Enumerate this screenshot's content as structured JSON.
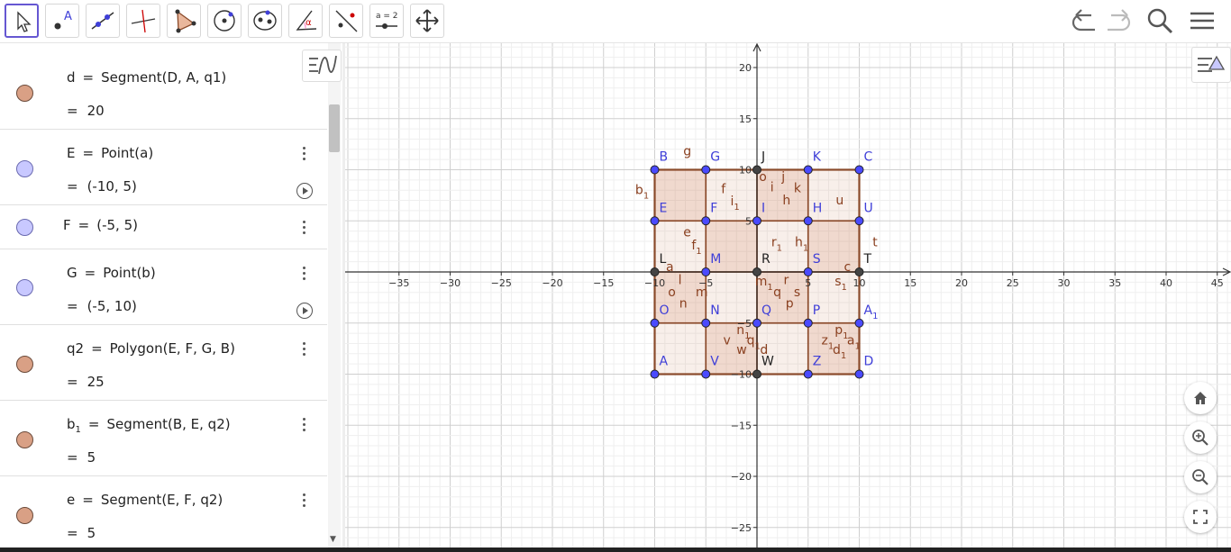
{
  "toolbar": {
    "tools": [
      {
        "name": "move-tool",
        "icon": "arrow-cursor-icon",
        "active": true
      },
      {
        "name": "point-tool",
        "icon": "point-icon",
        "label": "A"
      },
      {
        "name": "line-tool",
        "icon": "line-icon"
      },
      {
        "name": "perpendicular-line-tool",
        "icon": "perpendicular-icon"
      },
      {
        "name": "polygon-tool",
        "icon": "polygon-icon"
      },
      {
        "name": "circle-tool",
        "icon": "circle-icon"
      },
      {
        "name": "conic-tool",
        "icon": "ellipse-icon"
      },
      {
        "name": "angle-tool",
        "icon": "angle-icon",
        "label": "α"
      },
      {
        "name": "reflect-tool",
        "icon": "reflect-icon"
      },
      {
        "name": "slider-tool",
        "icon": "slider-icon",
        "label": "a = 2"
      },
      {
        "name": "move-graphics-tool",
        "icon": "move-arrows-icon"
      }
    ],
    "right": [
      "undo-icon",
      "redo-icon",
      "search-icon",
      "menu-icon"
    ]
  },
  "algebra": {
    "rows": [
      {
        "name": "d",
        "def": "d",
        "eqdef": "Segment(D, A, q1)",
        "value": "20",
        "color": "brown",
        "play": false
      },
      {
        "name": "E",
        "def": "E",
        "eqdef": "Point(a)",
        "value": "(-10, 5)",
        "color": "blue",
        "play": true
      },
      {
        "name": "F",
        "def": "F",
        "eqdef": "(-5, 5)",
        "value": "",
        "color": "blue",
        "play": false
      },
      {
        "name": "G",
        "def": "G",
        "eqdef": "Point(b)",
        "value": "(-5, 10)",
        "color": "blue",
        "play": true
      },
      {
        "name": "q2",
        "def": "q2",
        "eqdef": "Polygon(E, F, G, B)",
        "value": "25",
        "color": "brown",
        "play": false
      },
      {
        "name": "b1",
        "def": "b",
        "sub": "1",
        "eqdef": "Segment(B, E, q2)",
        "value": "5",
        "color": "brown",
        "play": false
      },
      {
        "name": "e",
        "def": "e",
        "eqdef": "Segment(E, F, q2)",
        "value": "5",
        "color": "brown",
        "play": false
      }
    ],
    "eq_sign": "="
  },
  "graph": {
    "xticks": [
      "−35",
      "−30",
      "−25",
      "−20",
      "−15",
      "−10",
      "−5",
      "5",
      "10",
      "15",
      "20",
      "25",
      "30",
      "35",
      "40",
      "45"
    ],
    "xtickvals": [
      -35,
      -30,
      -25,
      -20,
      -15,
      -10,
      -5,
      5,
      10,
      15,
      20,
      25,
      30,
      35,
      40,
      45
    ],
    "yticks": [
      "20",
      "15",
      "10",
      "5",
      "−5",
      "−10",
      "−15",
      "−20",
      "−25"
    ],
    "ytickvals": [
      20,
      15,
      10,
      5,
      -5,
      -10,
      -15,
      -20,
      -25
    ],
    "points_blue": [
      {
        "label": "B",
        "x": -10,
        "y": 10
      },
      {
        "label": "G",
        "x": -5,
        "y": 10
      },
      {
        "label": "K",
        "x": 5,
        "y": 10
      },
      {
        "label": "C",
        "x": 10,
        "y": 10
      },
      {
        "label": "E",
        "x": -10,
        "y": 5
      },
      {
        "label": "F",
        "x": -5,
        "y": 5
      },
      {
        "label": "I",
        "x": 0,
        "y": 5
      },
      {
        "label": "H",
        "x": 5,
        "y": 5
      },
      {
        "label": "U",
        "x": 10,
        "y": 5
      },
      {
        "label": "M",
        "x": -5,
        "y": 0
      },
      {
        "label": "S",
        "x": 5,
        "y": 0
      },
      {
        "label": "O",
        "x": -10,
        "y": -5
      },
      {
        "label": "N",
        "x": -5,
        "y": -5
      },
      {
        "label": "Q",
        "x": 0,
        "y": -5
      },
      {
        "label": "P",
        "x": 5,
        "y": -5
      },
      {
        "label": "A",
        "sub": "1",
        "x": 10,
        "y": -5
      },
      {
        "label": "A",
        "x": -10,
        "y": -10
      },
      {
        "label": "V",
        "x": -5,
        "y": -10
      },
      {
        "label": "Z",
        "x": 5,
        "y": -10
      },
      {
        "label": "D",
        "x": 10,
        "y": -10
      }
    ],
    "points_black": [
      {
        "label": "J",
        "x": 0,
        "y": 10
      },
      {
        "label": "L",
        "x": -10,
        "y": 0
      },
      {
        "label": "R",
        "x": 0,
        "y": 0
      },
      {
        "label": "T",
        "x": 10,
        "y": 0
      },
      {
        "label": "W",
        "x": 0,
        "y": -10
      }
    ],
    "segment_labels": [
      {
        "t": "g",
        "x": -7.2,
        "y": 11.4
      },
      {
        "t": "b",
        "sub": "1",
        "x": -11.9,
        "y": 7.6
      },
      {
        "t": "f",
        "x": -3.5,
        "y": 7.7
      },
      {
        "t": "i",
        "sub": "1",
        "x": -2.6,
        "y": 6.5
      },
      {
        "t": "o",
        "x": 0.2,
        "y": 8.9
      },
      {
        "t": "i",
        "x": 1.3,
        "y": 7.9
      },
      {
        "t": "j",
        "x": 2.4,
        "y": 8.9
      },
      {
        "t": "k",
        "x": 3.6,
        "y": 7.8
      },
      {
        "t": "h",
        "x": 2.5,
        "y": 6.6
      },
      {
        "t": "u",
        "x": 7.7,
        "y": 6.6
      },
      {
        "t": "e",
        "x": -7.2,
        "y": 3.5
      },
      {
        "t": "f",
        "sub": "1",
        "x": -6.4,
        "y": 2.2
      },
      {
        "t": "r",
        "sub": "1",
        "x": 1.4,
        "y": 2.5
      },
      {
        "t": "h",
        "sub": "1",
        "x": 3.7,
        "y": 2.5
      },
      {
        "t": "t",
        "x": 11.3,
        "y": 2.5
      },
      {
        "t": "a",
        "x": -8.9,
        "y": 0.1
      },
      {
        "t": "c",
        "x": 8.5,
        "y": 0.1
      },
      {
        "t": "l",
        "x": -7.7,
        "y": -1.2
      },
      {
        "t": "o",
        "x": -8.7,
        "y": -2.4
      },
      {
        "t": "m",
        "x": -6.0,
        "y": -2.4
      },
      {
        "t": "n",
        "x": -7.6,
        "y": -3.5
      },
      {
        "t": "m",
        "sub": "1",
        "x": -0.2,
        "y": -1.3
      },
      {
        "t": "q",
        "x": 1.6,
        "y": -2.4
      },
      {
        "t": "r",
        "x": 2.6,
        "y": -1.2
      },
      {
        "t": "s",
        "x": 3.6,
        "y": -2.4
      },
      {
        "t": "p",
        "x": 2.8,
        "y": -3.5
      },
      {
        "t": "s",
        "sub": "1",
        "x": 7.6,
        "y": -1.3
      },
      {
        "t": "n",
        "sub": "1",
        "x": -2.0,
        "y": -6.1
      },
      {
        "t": "q",
        "sub": "1",
        "x": -1.0,
        "y": -7.1
      },
      {
        "t": "v",
        "x": -3.3,
        "y": -7.1
      },
      {
        "t": "w",
        "x": -2.0,
        "y": -8.0
      },
      {
        "t": "d",
        "x": 0.3,
        "y": -8.0
      },
      {
        "t": "p",
        "sub": "1",
        "x": 7.6,
        "y": -6.1
      },
      {
        "t": "z",
        "sub": "1",
        "x": 6.3,
        "y": -7.1
      },
      {
        "t": "a",
        "sub": "1",
        "x": 8.8,
        "y": -7.1
      },
      {
        "t": "d",
        "sub": "1",
        "x": 7.4,
        "y": -8.0
      }
    ]
  },
  "colors": {
    "accent": "#6557d2",
    "polygon": "#8a4a2a",
    "fill": "#c87850",
    "point_blue": "#4a4aff",
    "label_blue": "#3f3fd8",
    "label_brown": "#8a4020"
  }
}
